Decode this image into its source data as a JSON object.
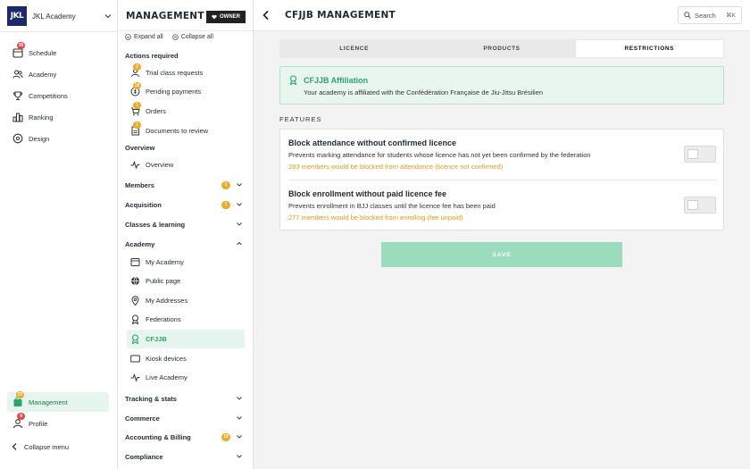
{
  "brand": {
    "logo_text": "JKL",
    "name": "JKL Academy"
  },
  "sidebar": {
    "items": [
      {
        "label": "Schedule",
        "icon": "calendar-icon",
        "badge": "30"
      },
      {
        "label": "Academy",
        "icon": "people-icon"
      },
      {
        "label": "Competitions",
        "icon": "trophy-icon"
      },
      {
        "label": "Ranking",
        "icon": "ranking-icon"
      },
      {
        "label": "Design",
        "icon": "palette-icon"
      }
    ],
    "bottom": [
      {
        "label": "Management",
        "icon": "management-icon",
        "badge": "33"
      },
      {
        "label": "Profile",
        "icon": "profile-icon",
        "badge": "9"
      }
    ],
    "collapse_label": "Collapse menu"
  },
  "panel": {
    "title": "MANAGEMENT",
    "owner_label": "OWNER",
    "expand_all": "Expand all",
    "collapse_all": "Collapse all",
    "actions_heading": "Actions required",
    "actions": [
      {
        "label": "Trial class requests",
        "badge": "2"
      },
      {
        "label": "Pending payments",
        "badge": "10"
      },
      {
        "label": "Orders",
        "badge": "1"
      },
      {
        "label": "Documents to review",
        "badge": "1"
      }
    ],
    "overview_heading": "Overview",
    "overview_item": "Overview",
    "groups_top": [
      {
        "label": "Members",
        "count": "1"
      },
      {
        "label": "Acquisition",
        "count": "1"
      },
      {
        "label": "Classes & learning",
        "count": ""
      },
      {
        "label": "Academy",
        "count": ""
      }
    ],
    "academy_items": [
      {
        "label": "My Academy",
        "icon": "academy-icon"
      },
      {
        "label": "Public page",
        "icon": "globe-icon"
      },
      {
        "label": "My Addresses",
        "icon": "location-pin-icon"
      },
      {
        "label": "Federations",
        "icon": "federation-icon"
      },
      {
        "label": "CFJJB",
        "icon": "cfjjb-icon"
      },
      {
        "label": "Kiosk devices",
        "icon": "monitor-icon"
      },
      {
        "label": "Live Academy",
        "icon": "activity-icon"
      }
    ],
    "groups_bottom": [
      {
        "label": "Tracking & stats",
        "count": ""
      },
      {
        "label": "Commerce",
        "count": ""
      },
      {
        "label": "Accounting & Billing",
        "count": "10"
      },
      {
        "label": "Compliance",
        "count": ""
      }
    ]
  },
  "main": {
    "title": "CFJJB MANAGEMENT",
    "search_label": "Search",
    "search_shortcut": "⌘K",
    "tabs": [
      {
        "label": "LICENCE",
        "active": false
      },
      {
        "label": "PRODUCTS",
        "active": false
      },
      {
        "label": "RESTRICTIONS",
        "active": true
      }
    ],
    "alert": {
      "title": "CFJJB Affiliation",
      "text": "Your academy is affiliated with the Confédération Française de Jiu-Jitsu Brésilien"
    },
    "features_heading": "FEATURES",
    "features": [
      {
        "title": "Block attendance without confirmed licence",
        "description": "Prevents marking attendance for students whose licence has not yet been confirmed by the federation",
        "warning": "283 members would be blocked from attendance (licence not confirmed)",
        "enabled": false
      },
      {
        "title": "Block enrollment without paid licence fee",
        "description": "Prevents enrollment in BJJ classes until the licence fee has been paid",
        "warning": "277 members would be blocked from enrolling (fee unpaid)",
        "enabled": false
      }
    ],
    "save_label": "SAVE"
  },
  "colors": {
    "accent": "#2aa66b",
    "warning": "#e59a17",
    "badge_red": "#e14b4b",
    "badge_orange": "#f0a92b",
    "brand": "#1c2a6b"
  }
}
